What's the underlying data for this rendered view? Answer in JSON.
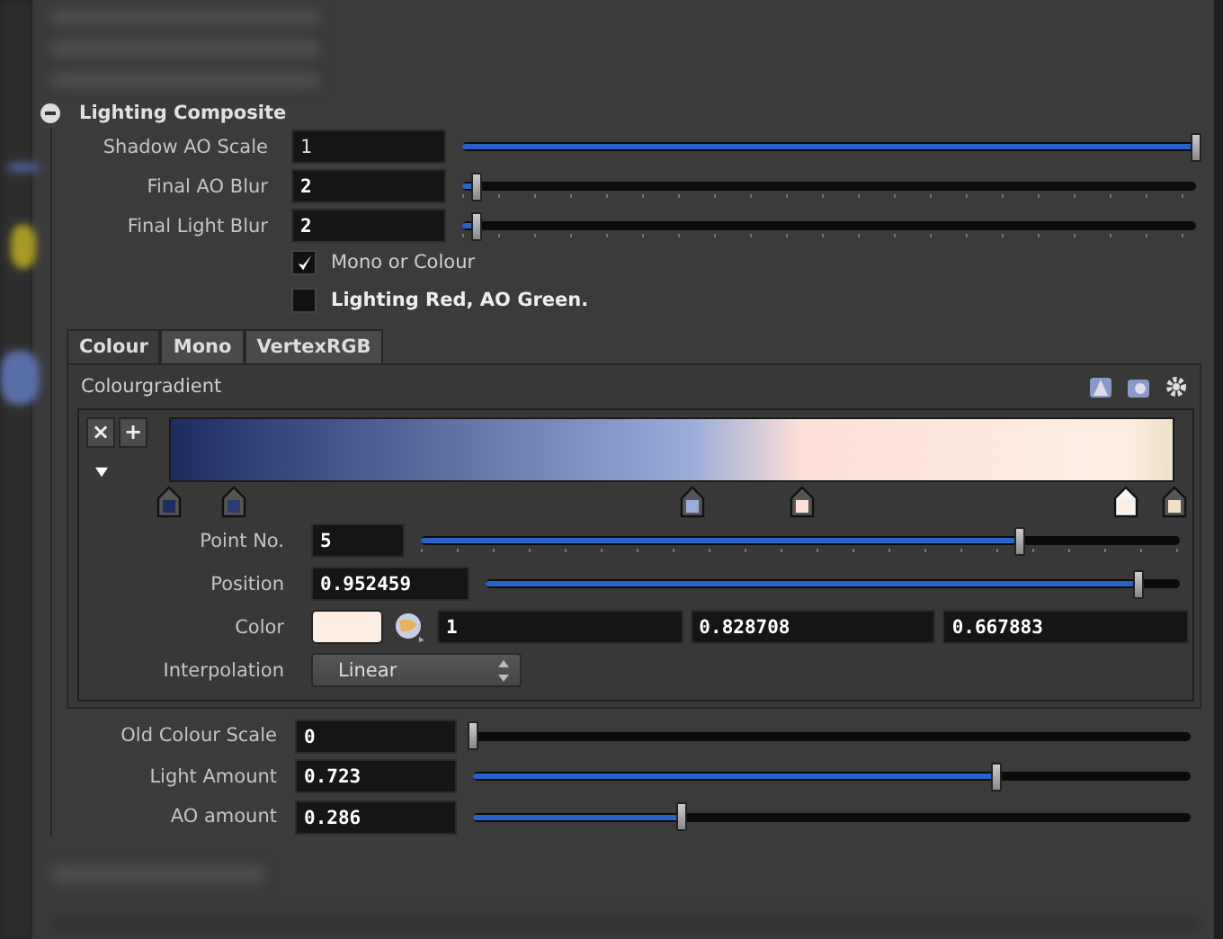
{
  "section": {
    "title": "Lighting Composite",
    "expanded": true
  },
  "params": [
    {
      "kind": "slider",
      "label": "Shadow AO Scale",
      "value": "1",
      "modified": false,
      "level": 1,
      "ticks": false
    },
    {
      "kind": "slider",
      "label": "Final AO Blur",
      "value": "2",
      "modified": true,
      "level": 0.02,
      "ticks": true
    },
    {
      "kind": "slider",
      "label": "Final Light Blur",
      "value": "2",
      "modified": true,
      "level": 0.02,
      "ticks": true
    },
    {
      "kind": "checkbox",
      "label": "Mono or Colour",
      "checked": true,
      "modified": false
    },
    {
      "kind": "checkbox",
      "label": "Lighting Red, AO Green.",
      "checked": false,
      "modified": true
    }
  ],
  "tabs": [
    {
      "label": "Colour",
      "selected": true
    },
    {
      "label": "Mono",
      "selected": false
    },
    {
      "label": "VertexRGB",
      "selected": false
    }
  ],
  "gradient": {
    "title": "Colourgradient",
    "buttons": [
      "×",
      "+"
    ],
    "stops": [
      {
        "level": 0,
        "color": "#1e2c5e",
        "selected": false
      },
      {
        "level": 0.065,
        "color": "#2c3d74",
        "selected": false
      },
      {
        "level": 0.52,
        "color": "#9aacd8",
        "selected": false
      },
      {
        "level": 0.63,
        "color": "#fde0d8",
        "selected": false
      },
      {
        "level": 0.952,
        "color": "#fdeee4",
        "selected": true
      },
      {
        "level": 1,
        "color": "#efe0c8",
        "selected": false
      }
    ],
    "params": [
      {
        "kind": "slider",
        "label": "Point No.",
        "value": "5",
        "modified": true,
        "level": 0.79,
        "ticks": true
      },
      {
        "kind": "slider",
        "label": "Position",
        "value": "0.952459",
        "modified": true,
        "level": 0.94,
        "ticks": false
      },
      {
        "kind": "color",
        "label": "Color",
        "color": "#fdeee4",
        "values": [
          "1",
          "0.828708",
          "0.667883"
        ]
      },
      {
        "kind": "menu",
        "label": "Interpolation",
        "value": "Linear"
      }
    ]
  },
  "after": [
    {
      "kind": "slider",
      "label": "Old Colour Scale",
      "value": "0",
      "modified": true,
      "level": 0,
      "ticks": false
    },
    {
      "kind": "slider",
      "label": "Light Amount",
      "value": "0.723",
      "modified": true,
      "level": 0.73,
      "ticks": false
    },
    {
      "kind": "slider",
      "label": "AO amount",
      "value": "0.286",
      "modified": true,
      "level": 0.29,
      "ticks": false
    }
  ]
}
